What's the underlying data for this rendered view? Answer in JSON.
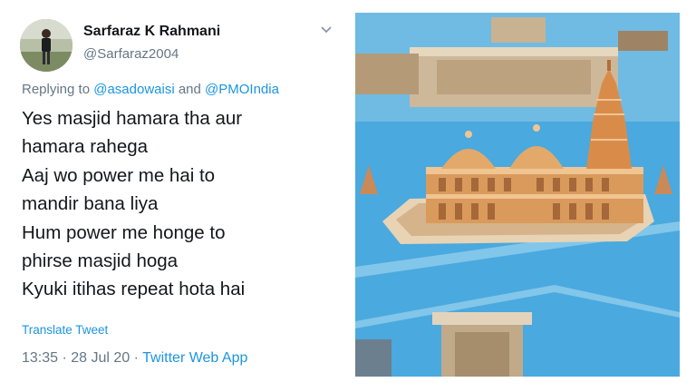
{
  "tweet": {
    "display_name": "Sarfaraz K Rahmani",
    "handle": "@Sarfaraz2004",
    "reply_prefix": "Replying to",
    "reply_to_1": "@asadowaisi",
    "reply_and": "and",
    "reply_to_2": "@PMOIndia",
    "lines": [
      "Yes masjid hamara tha aur",
      "hamara rahega",
      "Aaj wo power me hai to",
      "mandir bana liya",
      "Hum power me honge to",
      "phirse masjid hoga",
      "Kyuki itihas repeat hota hai"
    ],
    "translate_label": "Translate Tweet",
    "time": "13:35",
    "date": "28 Jul 20",
    "source": "Twitter Web App",
    "separator": "·"
  },
  "colors": {
    "text": "#14171a",
    "secondary": "#657786",
    "link": "#1b95e0",
    "water": "#4aa9de",
    "temple": "#d99a5b"
  },
  "icons": {
    "menu": "chevron-down-icon"
  }
}
